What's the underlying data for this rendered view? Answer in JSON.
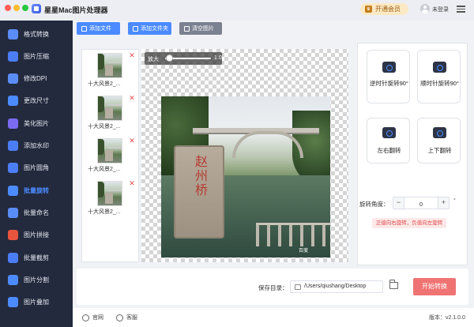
{
  "app": {
    "title": "星星Mac图片处理器"
  },
  "header": {
    "vip_label": "开通会员",
    "login_label": "未登录"
  },
  "sidebar": {
    "items": [
      {
        "label": "格式转换",
        "icon": "format-convert-icon",
        "color": "#5b8df7"
      },
      {
        "label": "图片压缩",
        "icon": "image-compress-icon",
        "color": "#4b7ef5"
      },
      {
        "label": "修改DPI",
        "icon": "modify-dpi-icon",
        "color": "#5b8df7"
      },
      {
        "label": "更改尺寸",
        "icon": "resize-icon",
        "color": "#4b8bff"
      },
      {
        "label": "美化图片",
        "icon": "beautify-icon",
        "color": "#7a6bf2"
      },
      {
        "label": "添加水印",
        "icon": "watermark-icon",
        "color": "#4b7ef5"
      },
      {
        "label": "图片圆角",
        "icon": "round-corner-icon",
        "color": "#4b7ef5"
      },
      {
        "label": "批量旋转",
        "icon": "batch-rotate-icon",
        "color": "#4b8bff",
        "active": true
      },
      {
        "label": "批量命名",
        "icon": "batch-rename-icon",
        "color": "#5b8df7"
      },
      {
        "label": "图片拼接",
        "icon": "image-stitch-icon",
        "color": "#e8543c"
      },
      {
        "label": "批量截剪",
        "icon": "batch-crop-icon",
        "color": "#4b7ef5"
      },
      {
        "label": "图片分割",
        "icon": "image-split-icon",
        "color": "#4b8bff"
      },
      {
        "label": "图片叠加",
        "icon": "image-overlay-icon",
        "color": "#4b8bff"
      }
    ]
  },
  "toolbar": {
    "add_file": "添加文件",
    "add_folder": "添加文件夹",
    "clear": "清空图片"
  },
  "files": [
    {
      "name": "十大风景2_..."
    },
    {
      "name": "十大风景2_..."
    },
    {
      "name": "十大风景2_..."
    },
    {
      "name": "十大风景2_..."
    }
  ],
  "preview": {
    "zoom_label": "放大",
    "zoom_value": "1.0",
    "zoom_level": 0.05,
    "tablet_text": "赵州桥",
    "watermark": "百度"
  },
  "operations": {
    "ccw": "逆时针旋转90°",
    "cw": "顺时针旋转90°",
    "flip_h": "左右翻转",
    "flip_v": "上下翻转",
    "angle_label": "旋转角度：",
    "angle_value": "0",
    "minus": "−",
    "plus": "+",
    "degree": "°",
    "hint": "正值向右旋转，负值向左旋转"
  },
  "save": {
    "label": "保存目录：",
    "path": "/Users/qiushang/Desktop",
    "start_label": "开始转换"
  },
  "footer": {
    "website": "官网",
    "service": "客服",
    "version": "版本：v2.1.0.0"
  }
}
